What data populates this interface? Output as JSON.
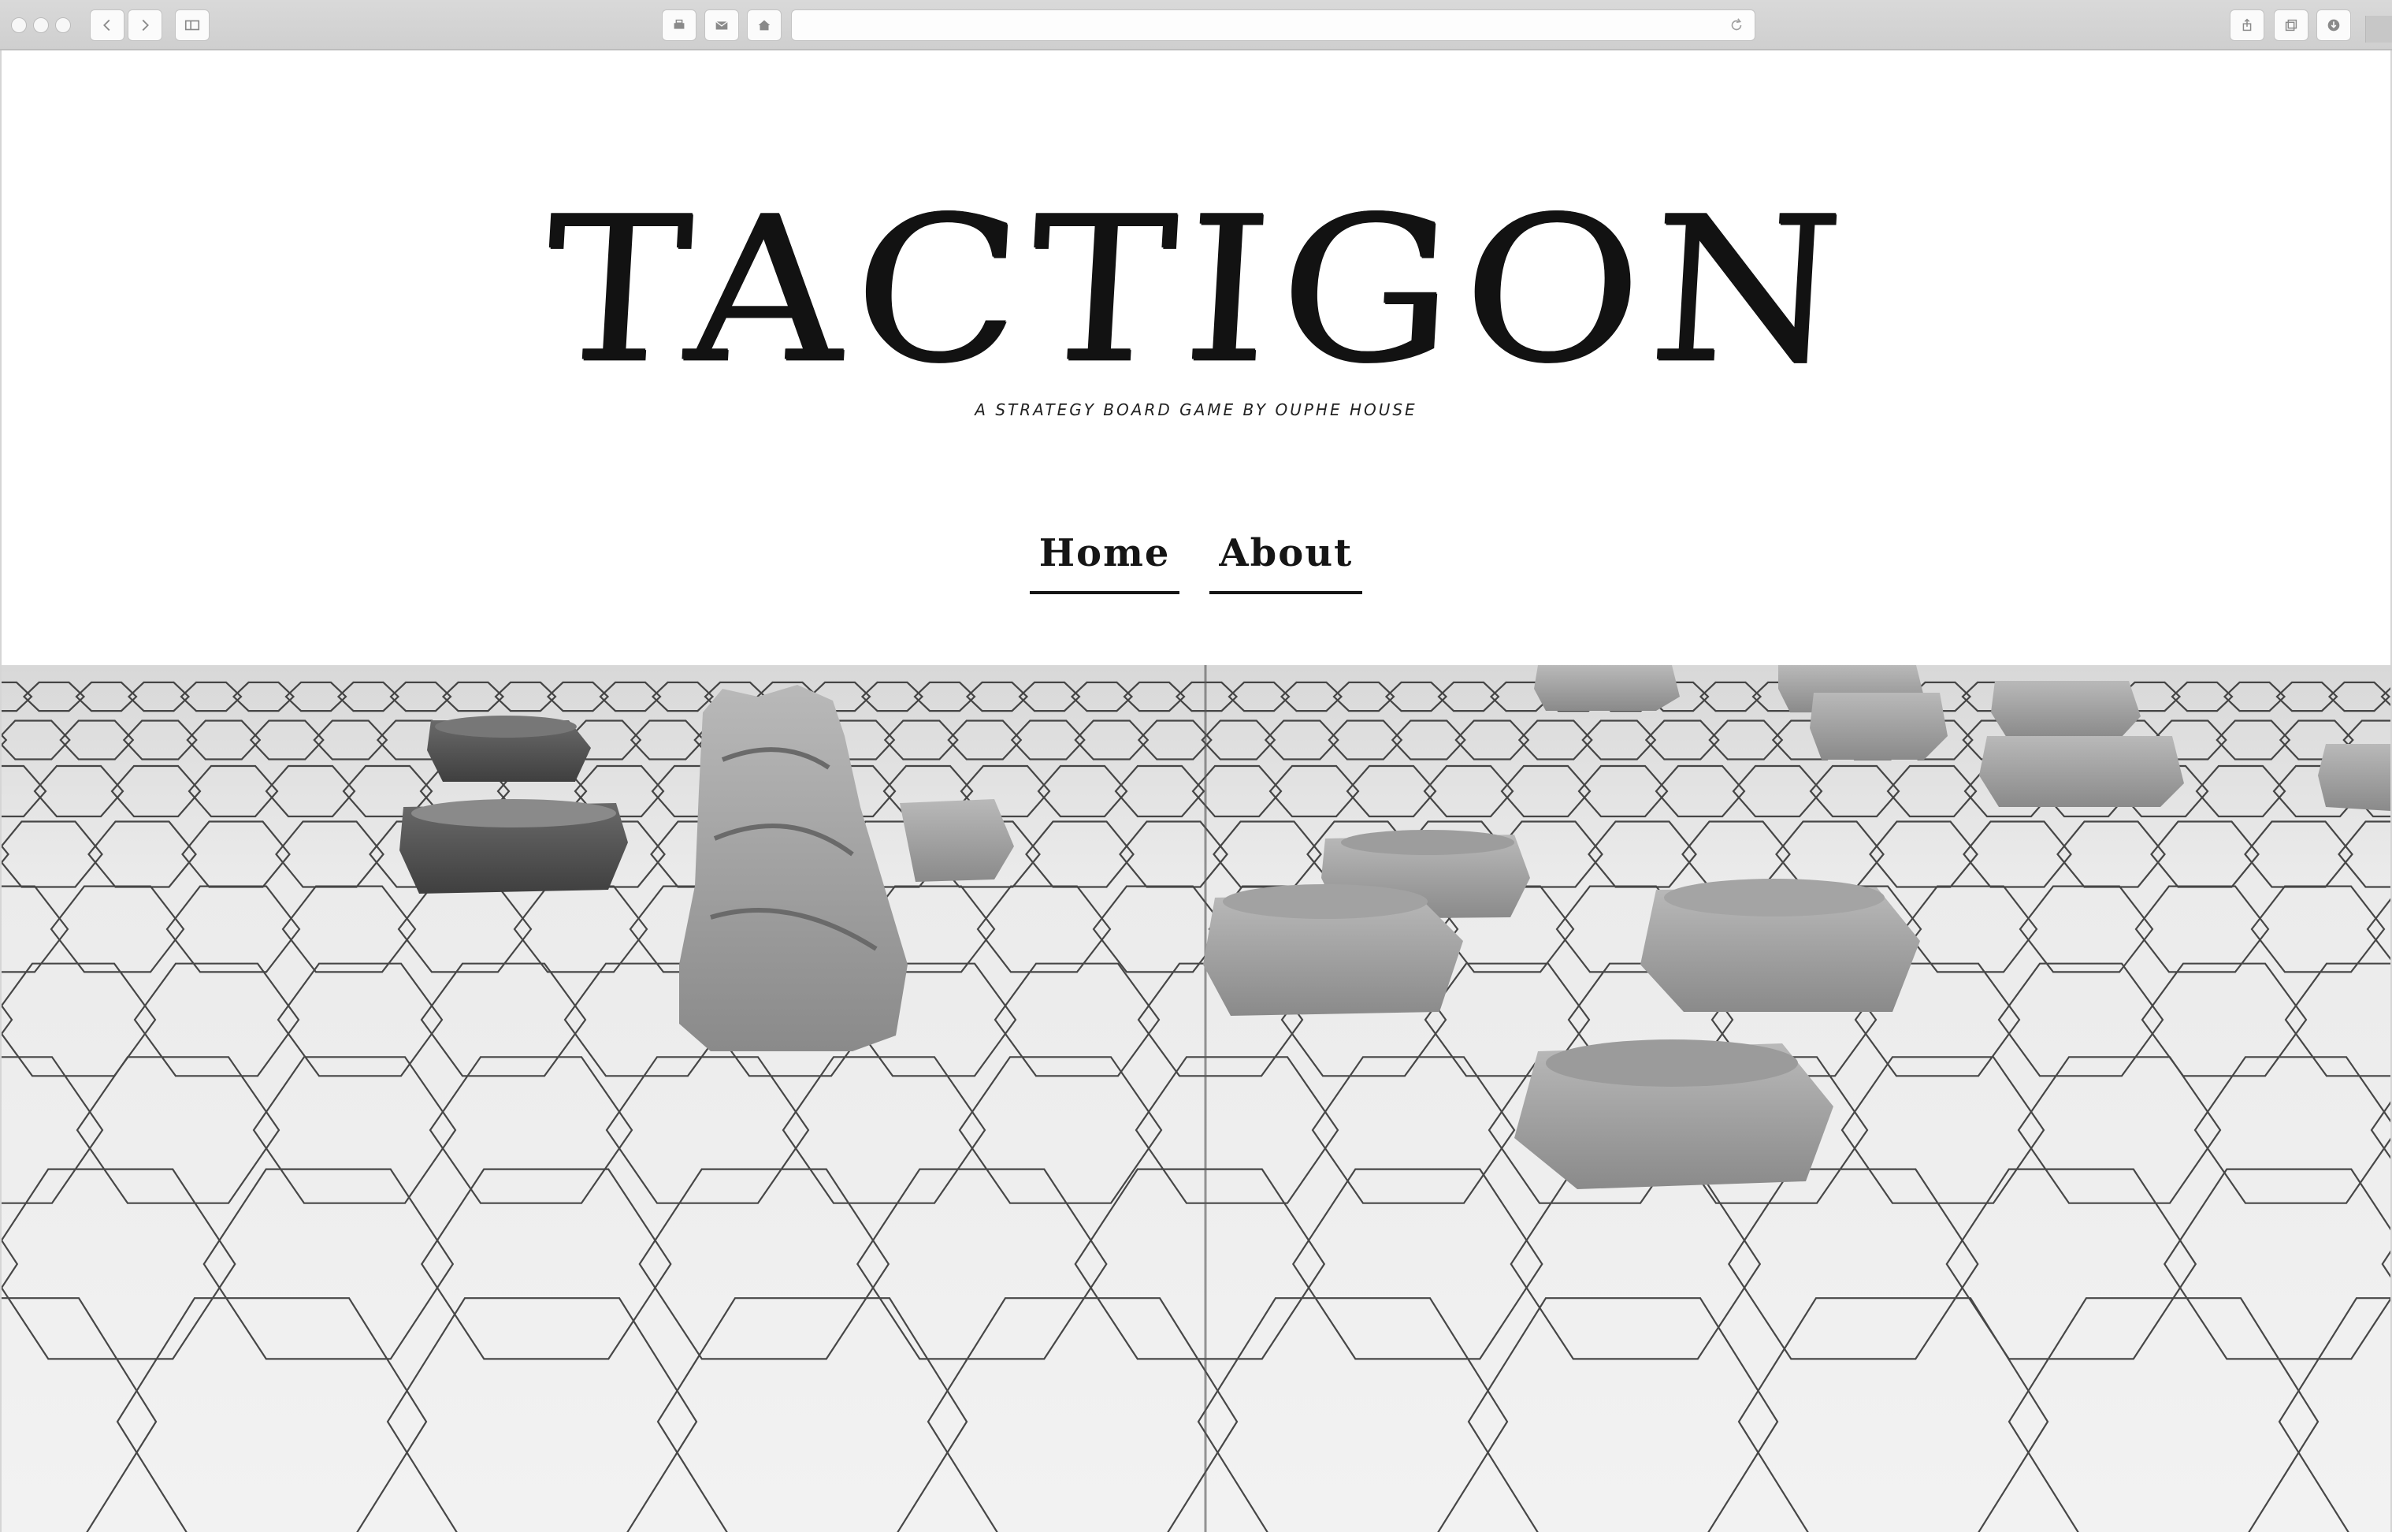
{
  "browser": {
    "toolbar_icons": [
      "back-icon",
      "forward-icon",
      "sidebar-icon",
      "print-icon",
      "mail-icon",
      "home-icon",
      "share-icon",
      "tabs-icon",
      "download-icon"
    ],
    "url": ""
  },
  "site": {
    "title": "TACTIGON",
    "tagline": "A STRATEGY BOARD GAME BY OUPHE HOUSE"
  },
  "nav": {
    "items": [
      {
        "label": "Home"
      },
      {
        "label": "About"
      }
    ]
  },
  "hero": {
    "image_desc": "black and white photo of stone game pieces on a hexagonal board"
  },
  "colors": {
    "text": "#151515",
    "background": "#ffffff",
    "chrome": "#d6d6d6"
  }
}
